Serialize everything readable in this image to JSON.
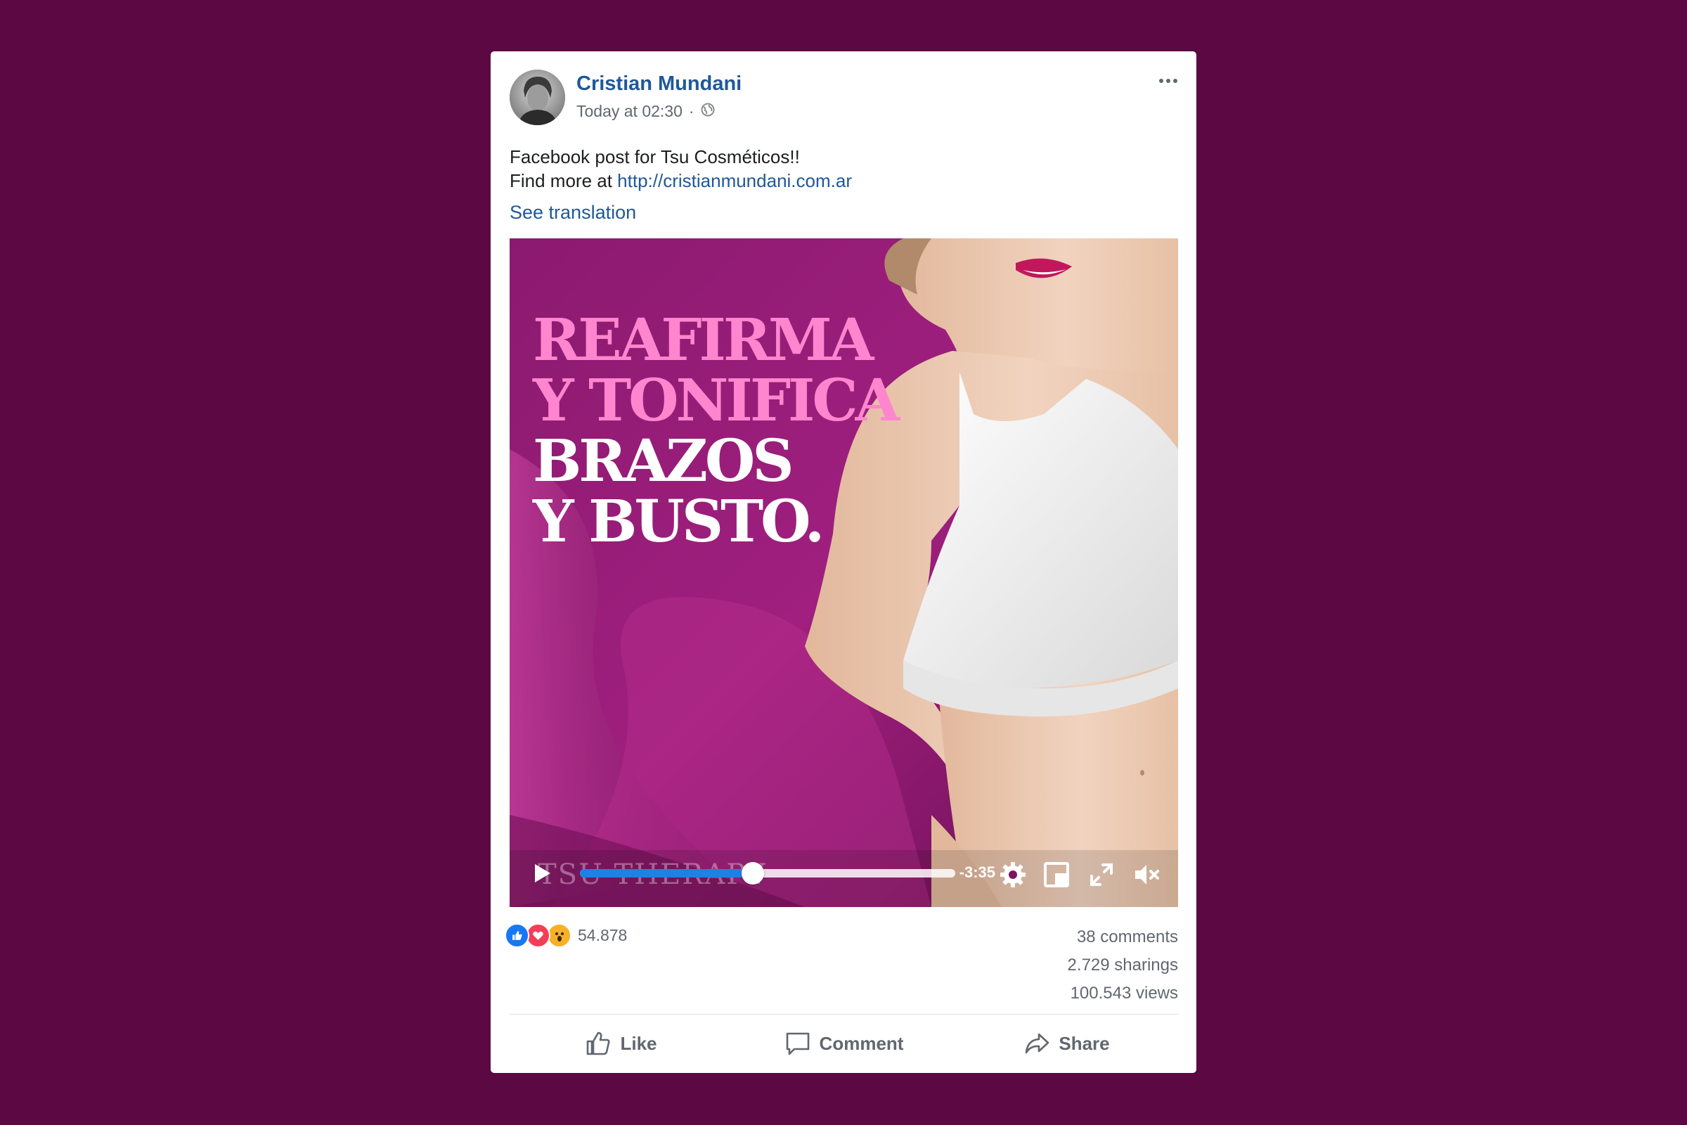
{
  "post": {
    "author": "Cristian Mundani",
    "timestamp": "Today at 02:30",
    "separator": "·",
    "audience_icon": "globe-icon",
    "more_icon": "more-options-icon",
    "text_line1": "Facebook post for Tsu Cosméticos!!",
    "text_line2_prefix": "Find more at ",
    "link_text": "http://cristianmundani.com.ar",
    "see_translation": "See translation"
  },
  "media": {
    "headline": [
      "REAFIRMA",
      "Y TONIFICA",
      "BRAZOS",
      "Y BUSTO."
    ],
    "brand": "TSU THERAPY",
    "video": {
      "time_remaining": "-3:35",
      "progress": 0.46,
      "icons": [
        "play-icon",
        "settings-icon",
        "picture-in-picture-icon",
        "fullscreen-icon",
        "muted-icon"
      ]
    }
  },
  "stats": {
    "reactions": [
      "like",
      "love",
      "wow"
    ],
    "reaction_count": "54.878",
    "comments": "38 comments",
    "sharings": "2.729 sharings",
    "views": "100.543 views"
  },
  "actions": {
    "like": "Like",
    "comment": "Comment",
    "share": "Share"
  },
  "colors": {
    "background": "#5c0843",
    "link": "#20589a",
    "progress": "#1b82e6",
    "headline_pink": "#ff86ce",
    "like": "#1877f2",
    "love": "#f33e58",
    "wow": "#f7b125"
  }
}
